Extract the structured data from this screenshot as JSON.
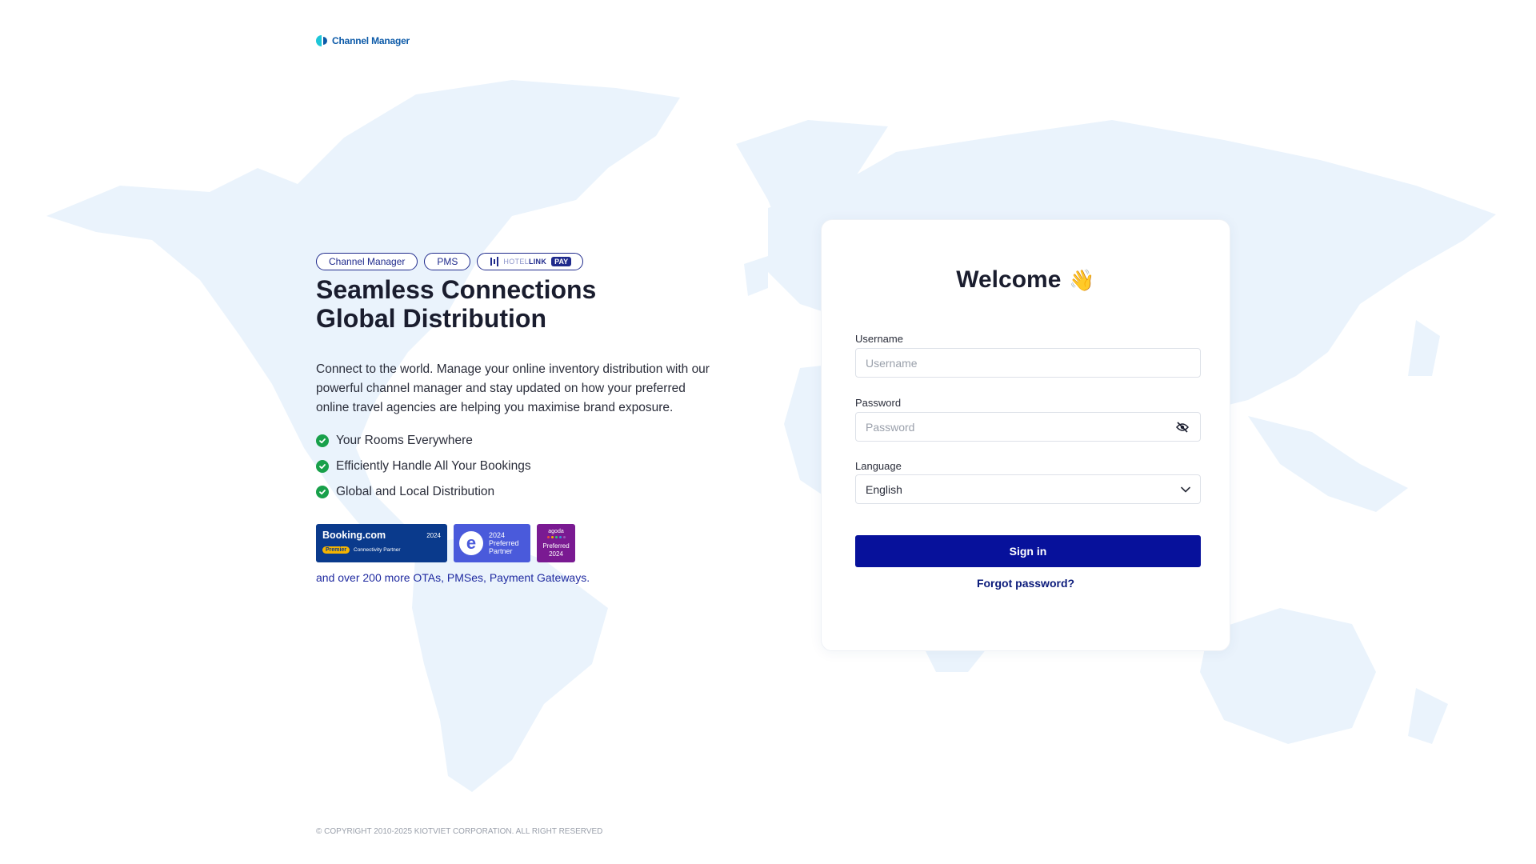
{
  "logo": {
    "text": "Channel Manager"
  },
  "hero": {
    "tags": [
      "Channel Manager",
      "PMS"
    ],
    "hotellink": {
      "prefix": "HOTEL",
      "strong": "LINK",
      "pay": "PAY"
    },
    "headline_line1": "Seamless Connections",
    "headline_line2": "Global Distribution",
    "description": "Connect to the world. Manage your online inventory distribution with our powerful channel manager and stay updated on how your preferred online travel agencies are helping you maximise brand exposure.",
    "features": [
      "Your Rooms Everywhere",
      "Efficiently Handle All Your Bookings",
      "Global and Local Distribution"
    ],
    "badges": {
      "booking": {
        "title": "Booking.com",
        "year": "2024",
        "tier": "Premier",
        "label": "Connectivity Partner"
      },
      "expedia": {
        "year": "2024",
        "line1": "Preferred",
        "line2": "Partner"
      },
      "agoda": {
        "logo": "agoda",
        "line1": "Preferred",
        "line2": "2024"
      }
    },
    "more": "and over 200 more OTAs, PMSes, Payment Gateways."
  },
  "login": {
    "title": "Welcome",
    "emoji": "👋",
    "username_label": "Username",
    "username_placeholder": "Username",
    "username_value": "",
    "password_label": "Password",
    "password_placeholder": "Password",
    "password_value": "",
    "language_label": "Language",
    "language_value": "English",
    "signin_label": "Sign in",
    "forgot_label": "Forgot password?"
  },
  "footer": {
    "copyright": "© COPYRIGHT 2010-2025 KIOTVIET CORPORATION. ALL RIGHT RESERVED"
  },
  "colors": {
    "brand_navy": "#07119b",
    "tag_border": "#1f2a8c",
    "check_green": "#18a04a",
    "map_fill": "#eaf3fc",
    "booking_blue": "#0a3a8c",
    "expedia_blue": "#4a5adb",
    "agoda_purple": "#7a1a92"
  },
  "icons": {
    "logo": "channel-manager-logo-icon",
    "check": "check-circle-icon",
    "eye": "eye-off-icon",
    "chevron": "chevron-down-icon"
  }
}
